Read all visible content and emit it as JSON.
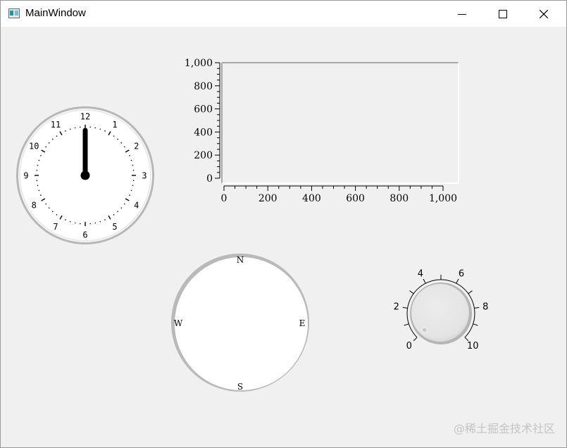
{
  "window": {
    "title": "MainWindow",
    "icon": "app-window-icon",
    "controls": {
      "minimize": "minimize-icon",
      "maximize": "maximize-icon",
      "close": "close-icon"
    }
  },
  "clock": {
    "numbers": [
      "12",
      "1",
      "2",
      "3",
      "4",
      "5",
      "6",
      "7",
      "8",
      "9",
      "10",
      "11"
    ],
    "hand_hour": 12
  },
  "chart_data": {
    "type": "line",
    "title": "",
    "xlabel": "",
    "ylabel": "",
    "xlim": [
      0,
      1000
    ],
    "ylim": [
      0,
      1000
    ],
    "x_ticks": [
      "0",
      "200",
      "400",
      "600",
      "800",
      "1,000"
    ],
    "y_ticks": [
      "0",
      "200",
      "400",
      "600",
      "800",
      "1,000"
    ],
    "series": [],
    "grid": false
  },
  "compass": {
    "labels": {
      "north": "N",
      "east": "E",
      "south": "S",
      "west": "W"
    }
  },
  "knob": {
    "labels": [
      "0",
      "2",
      "4",
      "6",
      "8",
      "10"
    ],
    "min": 0,
    "max": 10,
    "value": 0
  },
  "watermark": "@稀土掘金技术社区",
  "colors": {
    "background": "#f0f0f0",
    "face": "#ffffff",
    "ring": "#b4b4b4",
    "ink": "#000000"
  }
}
